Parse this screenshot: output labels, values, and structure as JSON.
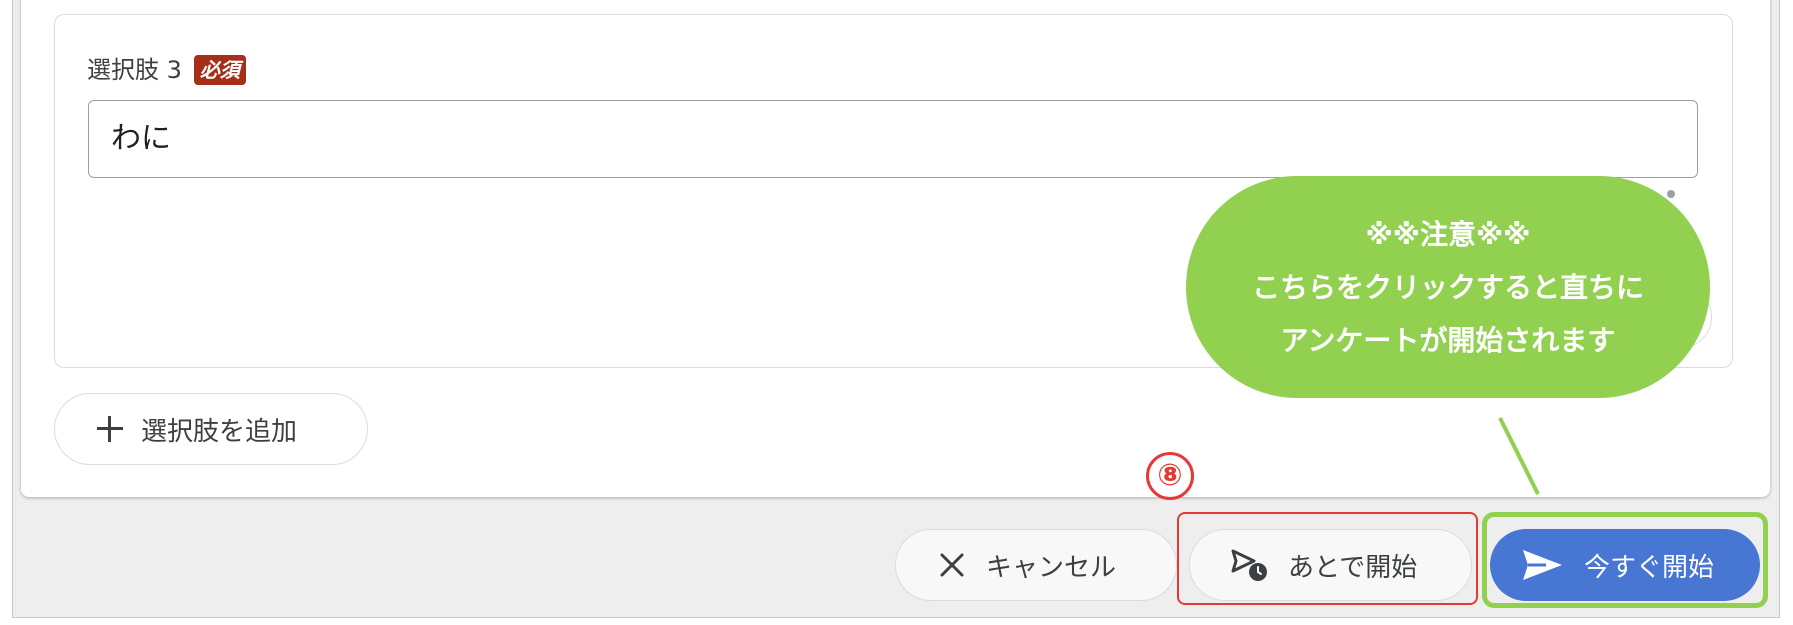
{
  "form": {
    "option_label": "選択肢 3",
    "required_badge": "必須",
    "option_value": "わに",
    "add_option_label": "選択肢を追加"
  },
  "actions": {
    "cancel_label": "キャンセル",
    "later_label": "あとで開始",
    "now_label": "今すぐ開始"
  },
  "annotation": {
    "step_number": "⑧",
    "callout_line1": "※※注意※※",
    "callout_line2": "こちらをクリックすると直ちに",
    "callout_line3": "アンケートが開始されます"
  },
  "colors": {
    "primary": "#4876d3",
    "required": "#a52f19",
    "callout": "#92d050",
    "highlight_red": "#e53935"
  },
  "icons": {
    "add": "plus-icon",
    "cancel": "close-icon",
    "later": "scheduled-send-icon",
    "now": "send-icon"
  }
}
